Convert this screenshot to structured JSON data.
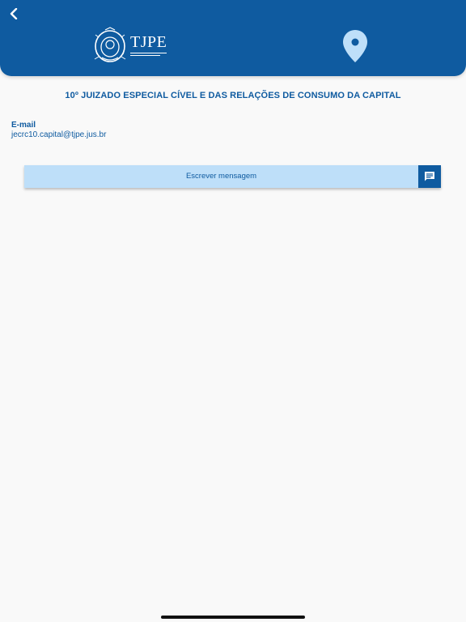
{
  "header": {
    "logo_text": "TJPE",
    "back_icon": "chevron-left-icon",
    "map_icon": "map-pin-icon",
    "background_color": "#0f5ba0"
  },
  "unit": {
    "title": "10º JUIZADO ESPECIAL CÍVEL E DAS RELAÇÕES DE CONSUMO DA CAPITAL"
  },
  "contact": {
    "email_label": "E-mail",
    "email_value": "jecrc10.capital@tjpe.jus.br"
  },
  "message_button": {
    "label": "Escrever mensagem",
    "icon": "message-icon",
    "background_color": "#bedff9"
  }
}
